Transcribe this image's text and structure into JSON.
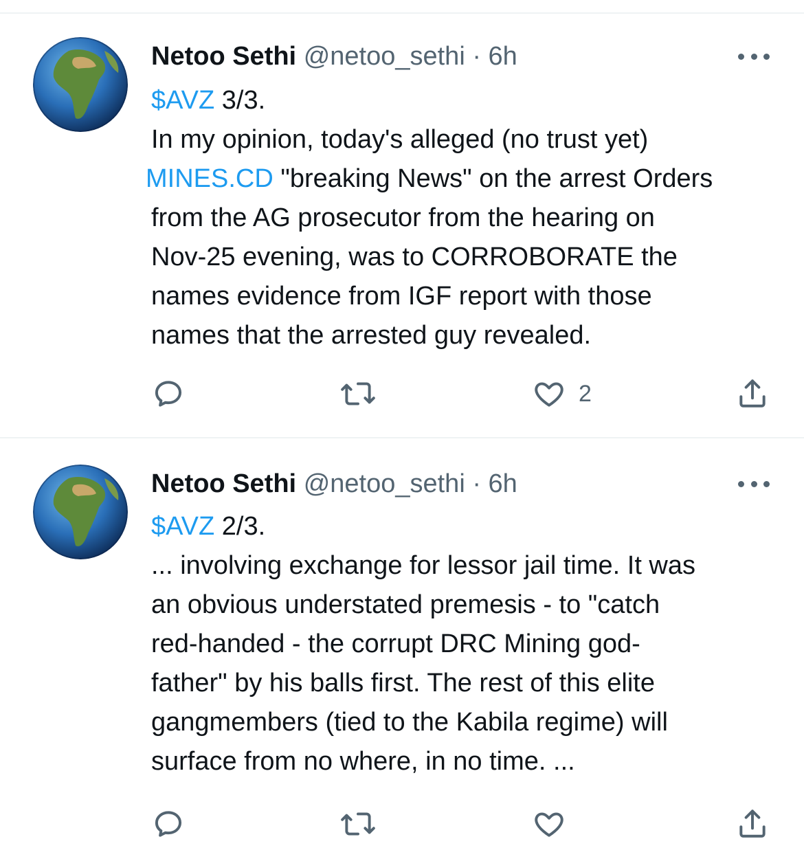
{
  "tweets": [
    {
      "author": "Netoo Sethi",
      "handle": "@netoo_sethi",
      "separator": "·",
      "time": "6h",
      "lines": [
        {
          "cashtag": "$AVZ",
          "text": " 3/3."
        },
        {
          "text": "In my opinion, today's alleged (no trust yet)"
        },
        {
          "link": "MINES.CD",
          "text": " \"breaking News\" on the arrest Orders"
        },
        {
          "text": "from the AG prosecutor from the hearing on"
        },
        {
          "text": "Nov-25 evening, was to CORROBORATE the"
        },
        {
          "text": "names evidence from IGF report with those"
        },
        {
          "text": "names that the arrested guy revealed."
        }
      ],
      "actions": {
        "reply": "",
        "retweet": "",
        "like": "2",
        "share": ""
      }
    },
    {
      "author": "Netoo Sethi",
      "handle": "@netoo_sethi",
      "separator": "·",
      "time": "6h",
      "lines": [
        {
          "cashtag": "$AVZ",
          "text": " 2/3."
        },
        {
          "text": "... involving exchange for lessor jail time. It was"
        },
        {
          "text": "an obvious understated premesis - to \"catch"
        },
        {
          "text": "red-handed - the corrupt DRC Mining god-"
        },
        {
          "text": "father\" by his balls first. The rest of this elite"
        },
        {
          "text": "gangmembers (tied to the Kabila regime) will"
        },
        {
          "text": "surface from no where, in no time. ..."
        }
      ]
    }
  ],
  "colors": {
    "link": "#1d9bf0",
    "secondary": "#536471",
    "text": "#0f1419",
    "divider": "#eff3f4"
  },
  "icons": [
    "earth-globe-avatar",
    "more-icon",
    "reply-icon",
    "retweet-icon",
    "like-icon",
    "share-icon"
  ]
}
